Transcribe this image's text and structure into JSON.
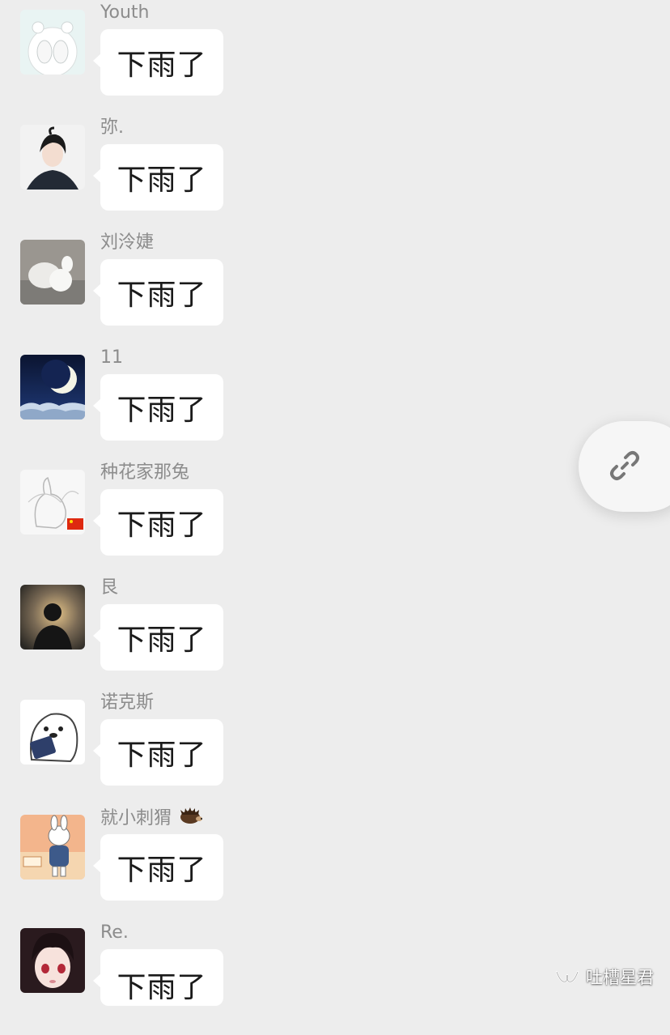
{
  "messages": [
    {
      "sender": "Youth",
      "text": "下雨了",
      "avatar": "polar-bear-avatar"
    },
    {
      "sender": "弥.",
      "text": "下雨了",
      "avatar": "anime-swordsman-avatar"
    },
    {
      "sender": "刘泠婕",
      "text": "下雨了",
      "avatar": "alpaca-avatar"
    },
    {
      "sender": "11",
      "text": "下雨了",
      "avatar": "crescent-moon-avatar"
    },
    {
      "sender": "种花家那兔",
      "text": "下雨了",
      "avatar": "rabbit-sketch-avatar"
    },
    {
      "sender": "艮",
      "text": "下雨了",
      "avatar": "silhouette-sunset-avatar"
    },
    {
      "sender": "诺克斯",
      "text": "下雨了",
      "avatar": "ghost-phone-avatar"
    },
    {
      "sender": "就小刺猬",
      "text": "下雨了",
      "avatar": "cartoon-rabbit-avatar"
    },
    {
      "sender": "Re.",
      "text": "下雨了",
      "avatar": "anime-girl-avatar"
    }
  ],
  "floating_button": {
    "icon": "link-icon"
  },
  "watermark": {
    "text": "吐槽星君",
    "icon": "wechat-channel-icon"
  },
  "colors": {
    "background": "#ededed",
    "bubble": "#ffffff",
    "sender_name": "#8c8c8c",
    "message_text": "#1a1a1a"
  }
}
